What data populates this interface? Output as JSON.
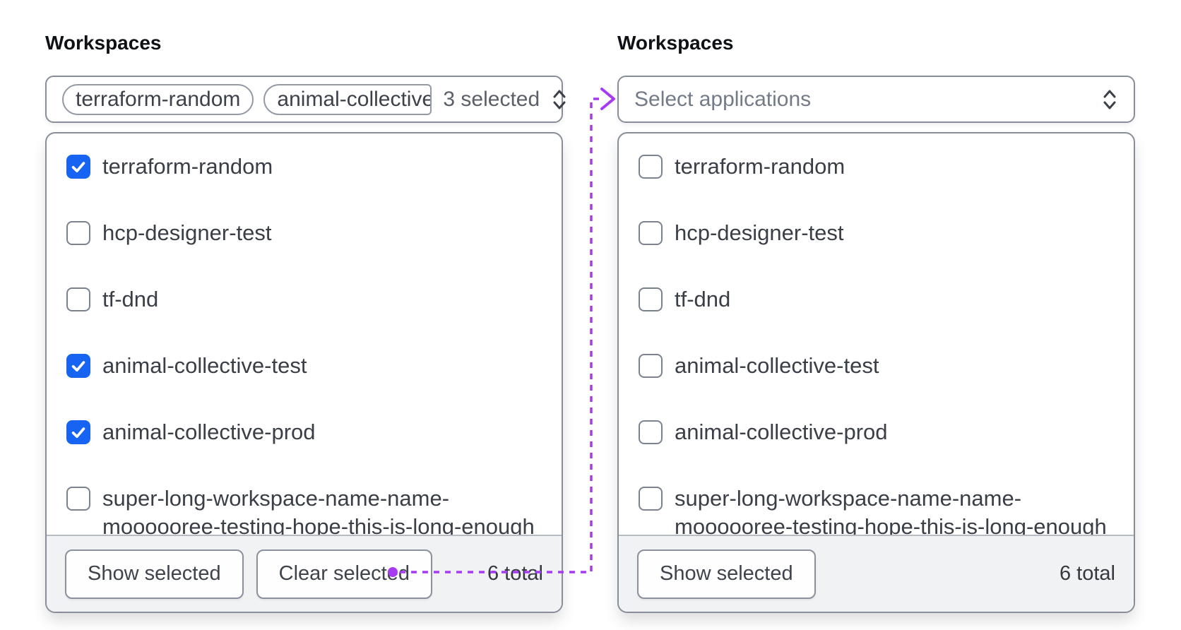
{
  "colors": {
    "checkbox_checked_blue": "#1764f2",
    "connector_purple": "#a63bef",
    "border_gray": "#878d99",
    "footer_background": "#f1f2f3"
  },
  "panels": [
    {
      "label": "Workspaces",
      "trigger": {
        "tags": [
          {
            "label": "terraform-random"
          },
          {
            "label": "animal-collective"
          }
        ],
        "summary": "3 selected"
      },
      "options": [
        {
          "label": "terraform-random",
          "checked": true
        },
        {
          "label": "hcp-designer-test",
          "checked": false
        },
        {
          "label": "tf-dnd",
          "checked": false
        },
        {
          "label": "animal-collective-test",
          "checked": true
        },
        {
          "label": "animal-collective-prod",
          "checked": true
        },
        {
          "label": "super-long-workspace-name-name-moooooree-testing-hope-this-is-long-enough",
          "checked": false
        }
      ],
      "footer": {
        "buttons": [
          {
            "label": "Show selected"
          },
          {
            "label": "Clear selected"
          }
        ],
        "total": "6 total"
      }
    },
    {
      "label": "Workspaces",
      "trigger": {
        "placeholder": "Select applications"
      },
      "options": [
        {
          "label": "terraform-random",
          "checked": false
        },
        {
          "label": "hcp-designer-test",
          "checked": false
        },
        {
          "label": "tf-dnd",
          "checked": false
        },
        {
          "label": "animal-collective-test",
          "checked": false
        },
        {
          "label": "animal-collective-prod",
          "checked": false
        },
        {
          "label": "super-long-workspace-name-name-moooooree-testing-hope-this-is-long-enough",
          "checked": false
        }
      ],
      "footer": {
        "buttons": [
          {
            "label": "Show selected"
          }
        ],
        "total": "6 total"
      }
    }
  ]
}
